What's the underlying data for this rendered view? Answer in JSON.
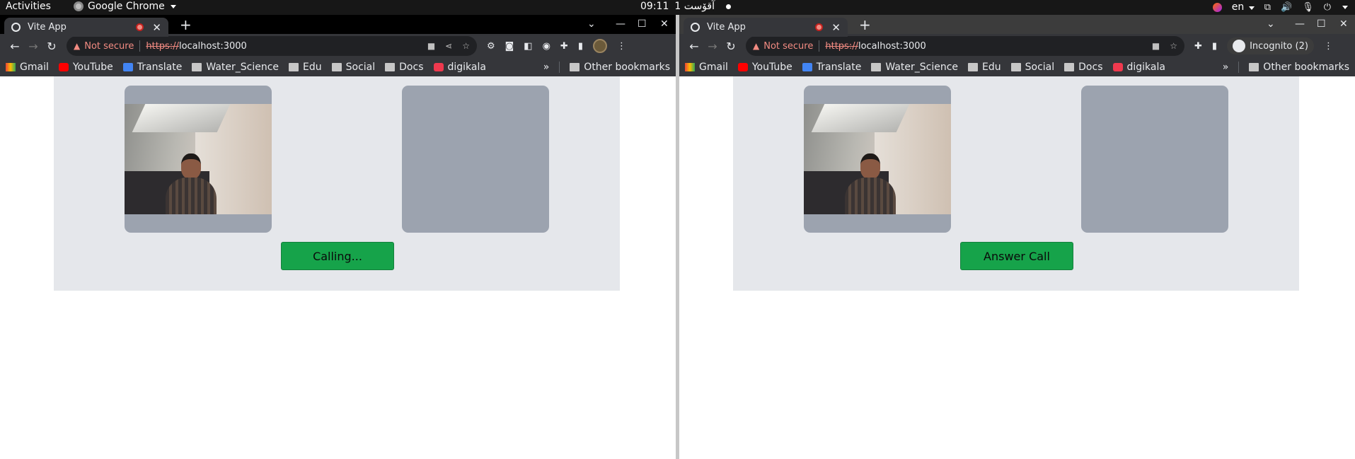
{
  "topbar": {
    "activities": "Activities",
    "app_name": "Google Chrome",
    "time": "09:11",
    "date": "1 آقۆست",
    "lang": "en"
  },
  "browser_left": {
    "tab_title": "Vite App",
    "not_secure": "Not secure",
    "url_scheme": "https://",
    "url_host": "localhost:3000",
    "bookmarks": [
      "Gmail",
      "YouTube",
      "Translate",
      "Water_Science",
      "Edu",
      "Social",
      "Docs",
      "digikala"
    ],
    "bookmarks_more": "»",
    "other_bookmarks": "Other bookmarks",
    "button_label": "Calling..."
  },
  "browser_right": {
    "tab_title": "Vite App",
    "not_secure": "Not secure",
    "url_scheme": "https://",
    "url_host": "localhost:3000",
    "incognito": "Incognito (2)",
    "bookmarks": [
      "Gmail",
      "YouTube",
      "Translate",
      "Water_Science",
      "Edu",
      "Social",
      "Docs",
      "digikala"
    ],
    "bookmarks_more": "»",
    "other_bookmarks": "Other bookmarks",
    "button_label": "Answer Call"
  },
  "colors": {
    "panel_bg": "#e5e7eb",
    "video_placeholder": "#9ca3af",
    "button_green": "#16a34a"
  }
}
